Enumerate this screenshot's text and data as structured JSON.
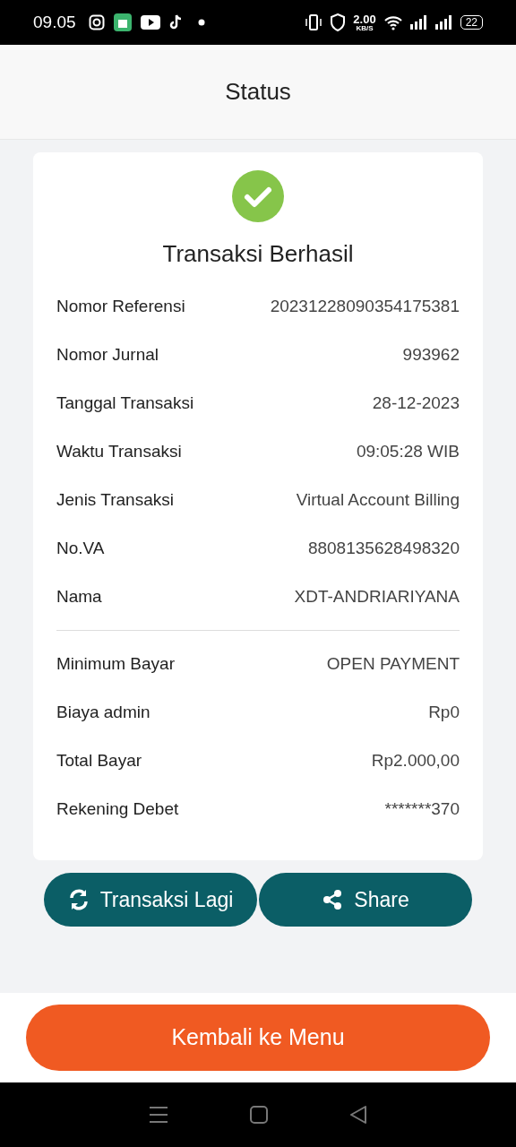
{
  "status_bar": {
    "time": "09.05",
    "speed": "2.00",
    "speed_unit": "KB/S",
    "battery": "22"
  },
  "header": {
    "title": "Status"
  },
  "receipt": {
    "title": "Transaksi Berhasil",
    "details": [
      {
        "label": "Nomor Referensi",
        "value": "20231228090354175381"
      },
      {
        "label": "Nomor Jurnal",
        "value": "993962"
      },
      {
        "label": "Tanggal Transaksi",
        "value": "28-12-2023"
      },
      {
        "label": "Waktu Transaksi",
        "value": "09:05:28 WIB"
      },
      {
        "label": "Jenis Transaksi",
        "value": "Virtual Account Billing"
      },
      {
        "label": "No.VA",
        "value": "8808135628498320"
      },
      {
        "label": "Nama",
        "value": "XDT-ANDRIARIYANA"
      }
    ],
    "payment": [
      {
        "label": "Minimum Bayar",
        "value": "OPEN PAYMENT"
      },
      {
        "label": "Biaya admin",
        "value": "Rp0"
      },
      {
        "label": "Total Bayar",
        "value": "Rp2.000,00"
      },
      {
        "label": "Rekening Debet",
        "value": "*******370"
      }
    ]
  },
  "actions": [
    {
      "kind": "repeat",
      "label": "Transaksi Lagi"
    },
    {
      "kind": "share",
      "label": "Share"
    }
  ],
  "back_button": "Kembali ke Menu"
}
